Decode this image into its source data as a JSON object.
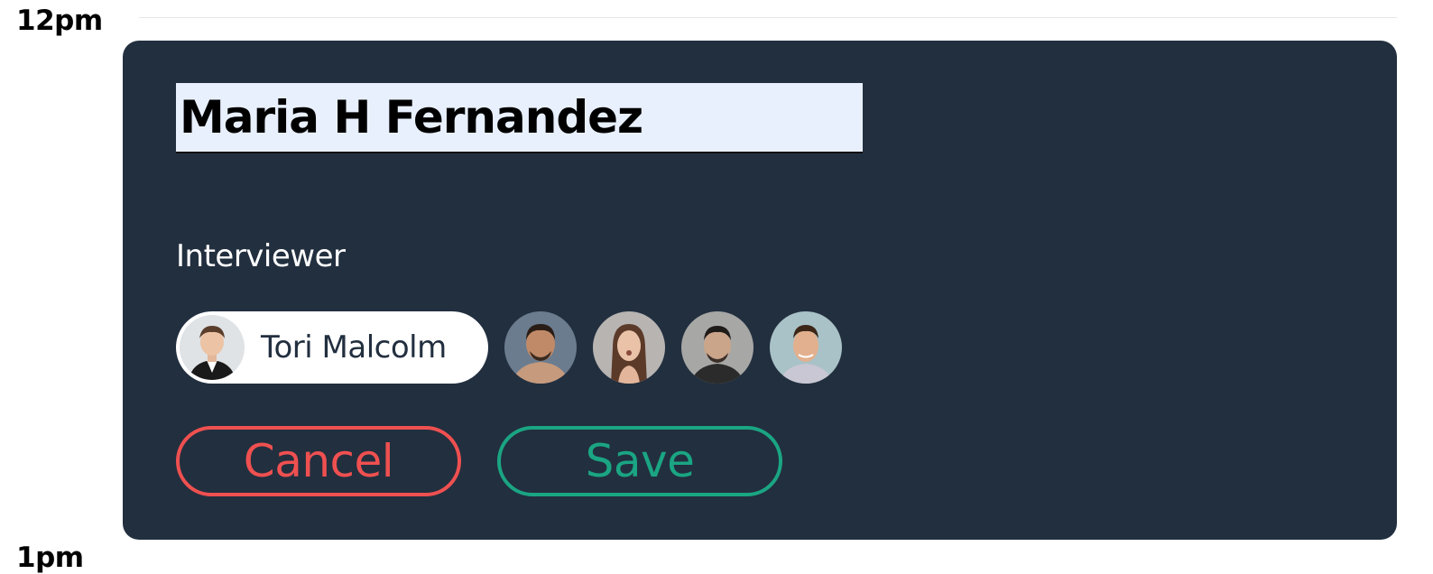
{
  "calendar": {
    "time_labels": [
      "12pm",
      "1pm"
    ]
  },
  "event_form": {
    "title_value": "Maria H Fernandez",
    "interviewer_label": "Interviewer",
    "selected_interviewer": {
      "name": "Tori Malcolm",
      "avatar_icon": "person-avatar-icon"
    },
    "other_interviewers": [
      {
        "avatar_icon": "person-avatar-icon"
      },
      {
        "avatar_icon": "person-avatar-icon"
      },
      {
        "avatar_icon": "person-avatar-icon"
      },
      {
        "avatar_icon": "person-avatar-icon"
      }
    ],
    "cancel_label": "Cancel",
    "save_label": "Save"
  },
  "colors": {
    "card_background": "#222f3f",
    "cancel": "#ef5050",
    "save": "#1aa583",
    "input_background": "#e8f0fe"
  }
}
